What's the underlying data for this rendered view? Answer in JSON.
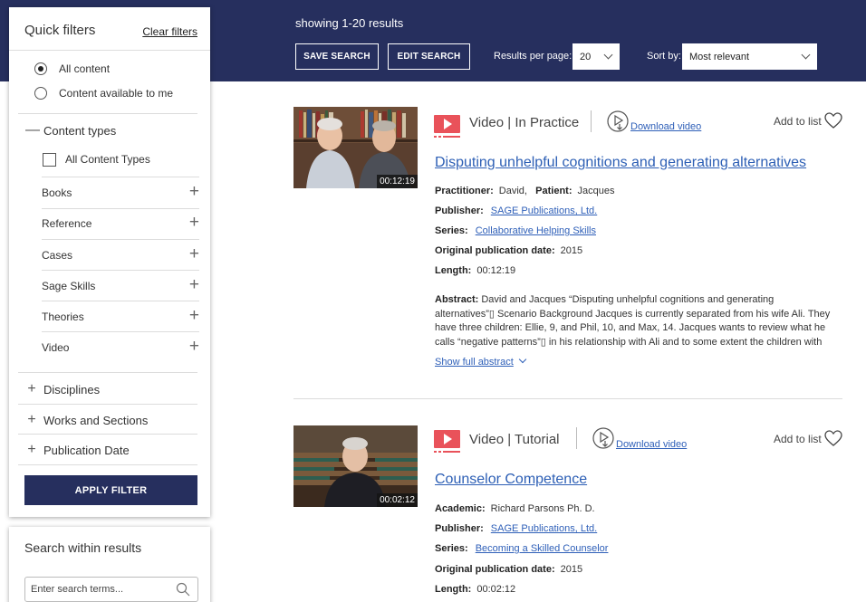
{
  "header": {
    "results_text": "showing 1-20 results",
    "save_search": "SAVE SEARCH",
    "edit_search": "EDIT SEARCH",
    "results_per_page_label": "Results per page:",
    "results_per_page_value": "20",
    "sort_label": "Sort by:",
    "sort_value": "Most relevant"
  },
  "quick_filters": {
    "title": "Quick filters",
    "clear": "Clear filters",
    "radio_options": [
      {
        "label": "All content",
        "selected": true
      },
      {
        "label": "Content available to me",
        "selected": false
      }
    ],
    "content_types": {
      "title": "Content types",
      "all_label": "All Content Types",
      "items": [
        "Books",
        "Reference",
        "Cases",
        "Sage Skills",
        "Theories",
        "Video"
      ]
    },
    "collapsed_sections": [
      "Disciplines",
      "Works and Sections",
      "Publication Date"
    ],
    "apply": "APPLY FILTER"
  },
  "search_within": {
    "title": "Search within results",
    "placeholder": "Enter search terms..."
  },
  "results": [
    {
      "duration": "00:12:19",
      "type": "Video | In Practice",
      "download": "Download video",
      "add_to_list": "Add to list",
      "title": "Disputing unhelpful cognitions and generating alternatives",
      "role1_label": "Practitioner:",
      "role1_value": "David,",
      "role2_label": "Patient:",
      "role2_value": "Jacques",
      "publisher_label": "Publisher:",
      "publisher": "SAGE Publications, Ltd.",
      "series_label": "Series:",
      "series": "Collaborative Helping Skills",
      "pubdate_label": "Original publication date:",
      "pubdate": "2015",
      "length_label": "Length:",
      "length": "00:12:19",
      "abstract_label": "Abstract:",
      "abstract": "David and Jacques “Disputing unhelpful cognitions and generating alternatives”▯ Scenario Background Jacques is currently separated from his wife Ali. They have three children: Ellie, 9, and Phil, 10, and Max, 14. Jacques wants to review what he calls “negative patterns”▯ in his relationship with Ali and to some extent the children with the hope of",
      "show_full": "Show full abstract"
    },
    {
      "duration": "00:02:12",
      "type": "Video | Tutorial",
      "download": "Download video",
      "add_to_list": "Add to list",
      "title": "Counselor Competence",
      "role1_label": "Academic:",
      "role1_value": "Richard Parsons Ph. D.",
      "publisher_label": "Publisher:",
      "publisher": "SAGE Publications, Ltd.",
      "series_label": "Series:",
      "series": "Becoming a Skilled Counselor",
      "pubdate_label": "Original publication date:",
      "pubdate": "2015",
      "length_label": "Length:",
      "length": "00:02:12"
    }
  ],
  "colors": {
    "navy": "#262f5e",
    "link_blue": "#2d5fb5",
    "play_red": "#e9525a"
  }
}
